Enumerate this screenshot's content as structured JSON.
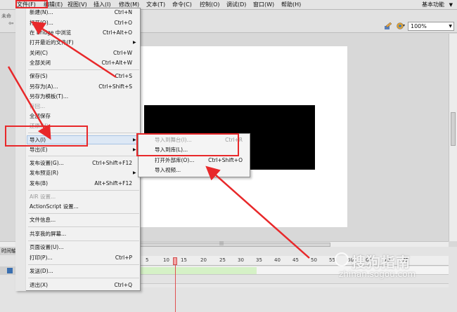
{
  "menubar": {
    "items": [
      "文件(F)",
      "编辑(E)",
      "视图(V)",
      "插入(I)",
      "修改(M)",
      "文本(T)",
      "命令(C)",
      "控制(O)",
      "调试(D)",
      "窗口(W)",
      "帮助(H)"
    ],
    "workspace": "基本功能"
  },
  "toolbar": {
    "doc_tab": "未命",
    "zoom": "100%"
  },
  "file_menu": {
    "items": [
      {
        "label": "新建(N)...",
        "shortcut": "Ctrl+N"
      },
      {
        "label": "打开(O)...",
        "shortcut": "Ctrl+O"
      },
      {
        "label": "在 Bridge 中浏览",
        "shortcut": "Ctrl+Alt+O"
      },
      {
        "label": "打开最近的文件(F)",
        "shortcut": ""
      },
      {
        "label": "关闭(C)",
        "shortcut": "Ctrl+W"
      },
      {
        "label": "全部关闭",
        "shortcut": "Ctrl+Alt+W"
      },
      {
        "label": "保存(S)",
        "shortcut": "Ctrl+S"
      },
      {
        "label": "另存为(A)...",
        "shortcut": "Ctrl+Shift+S"
      },
      {
        "label": "另存为模板(T)...",
        "shortcut": ""
      },
      {
        "label": "存回...",
        "shortcut": ""
      },
      {
        "label": "全部保存",
        "shortcut": ""
      },
      {
        "label": "还原(H)",
        "shortcut": ""
      },
      {
        "label": "导入(I)",
        "shortcut": ""
      },
      {
        "label": "导出(E)",
        "shortcut": ""
      },
      {
        "label": "发布设置(G)...",
        "shortcut": "Ctrl+Shift+F12"
      },
      {
        "label": "发布预览(R)",
        "shortcut": ""
      },
      {
        "label": "发布(B)",
        "shortcut": "Alt+Shift+F12"
      },
      {
        "label": "AIR 设置...",
        "shortcut": ""
      },
      {
        "label": "ActionScript 设置...",
        "shortcut": ""
      },
      {
        "label": "文件信息...",
        "shortcut": ""
      },
      {
        "label": "共享我的屏幕...",
        "shortcut": ""
      },
      {
        "label": "页面设置(U)...",
        "shortcut": ""
      },
      {
        "label": "打印(P)...",
        "shortcut": "Ctrl+P"
      },
      {
        "label": "发送(D)...",
        "shortcut": ""
      },
      {
        "label": "退出(X)",
        "shortcut": "Ctrl+Q"
      }
    ]
  },
  "import_submenu": {
    "items": [
      {
        "label": "导入到舞台(I)...",
        "shortcut": "Ctrl+R"
      },
      {
        "label": "导入到库(L)...",
        "shortcut": ""
      },
      {
        "label": "打开外部库(O)...",
        "shortcut": "Ctrl+Shift+O"
      },
      {
        "label": "导入视频...",
        "shortcut": ""
      }
    ]
  },
  "timeline": {
    "tab": "时间轴",
    "ruler": [
      "5",
      "10",
      "15",
      "20",
      "25",
      "30",
      "35",
      "40",
      "45",
      "50",
      "55",
      "60",
      "65",
      "70",
      "75"
    ]
  },
  "watermark": {
    "logo": "搜狗指南",
    "url": "zhinan.sogou.com"
  },
  "colors": {
    "annotation": "#e8282a",
    "canvas": "#ffffff",
    "shape": "#000000"
  }
}
